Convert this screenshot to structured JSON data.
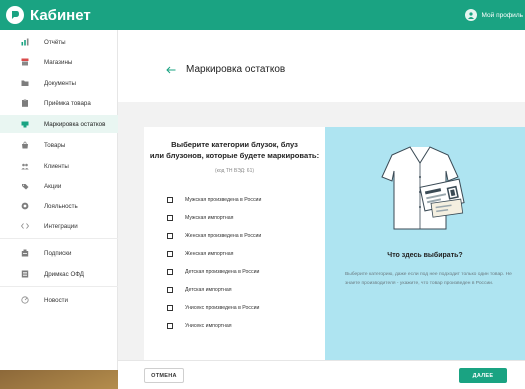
{
  "header": {
    "brand": "Кабинет",
    "profile_label": "Мой профиль"
  },
  "sidebar": {
    "items": [
      {
        "label": "Отчёты",
        "icon": "reports-icon"
      },
      {
        "label": "Магазины",
        "icon": "store-icon"
      },
      {
        "label": "Документы",
        "icon": "folder-icon"
      },
      {
        "label": "Приёмка товара",
        "icon": "clipboard-icon"
      },
      {
        "label": "Маркировка остатков",
        "icon": "scanner-icon",
        "active": true
      },
      {
        "label": "Товары",
        "icon": "bag-icon"
      },
      {
        "label": "Клиенты",
        "icon": "clients-icon"
      },
      {
        "label": "Акции",
        "icon": "promo-icon"
      },
      {
        "label": "Лояльность",
        "icon": "loyalty-icon"
      },
      {
        "label": "Интеграции",
        "icon": "integrations-icon"
      },
      {
        "label": "Подписки",
        "icon": "subscriptions-icon"
      },
      {
        "label": "Дримкас ОФД",
        "icon": "ofd-icon"
      },
      {
        "label": "Новости",
        "icon": "news-icon"
      }
    ]
  },
  "page": {
    "title": "Маркировка остатков",
    "back_icon": "back-arrow-icon"
  },
  "question": {
    "title_line1": "Выберите категории блузок, блуз",
    "title_line2": "или блузонов, которые будете маркировать:",
    "subtitle": "(код ТН ВЭД: 61)",
    "options": [
      "Мужская произведена в России",
      "Мужская импортная",
      "Женская произведена в России",
      "Женская импортная",
      "Детская произведена в России",
      "Детская импортная",
      "Унисекс произведена в России",
      "Унисекс импортная"
    ]
  },
  "info": {
    "title": "Что здесь выбирать?",
    "text": "Выберите категорию, даже если под нее подходит только один товар. Не знаете производителя - укажите, что товар произведен в России."
  },
  "footer": {
    "cancel_label": "ОТМЕНА",
    "next_label": "ДАЛЕЕ"
  },
  "colors": {
    "accent": "#1aa382",
    "info_panel": "#aee4f1",
    "active_nav": "#e9f6f2"
  }
}
